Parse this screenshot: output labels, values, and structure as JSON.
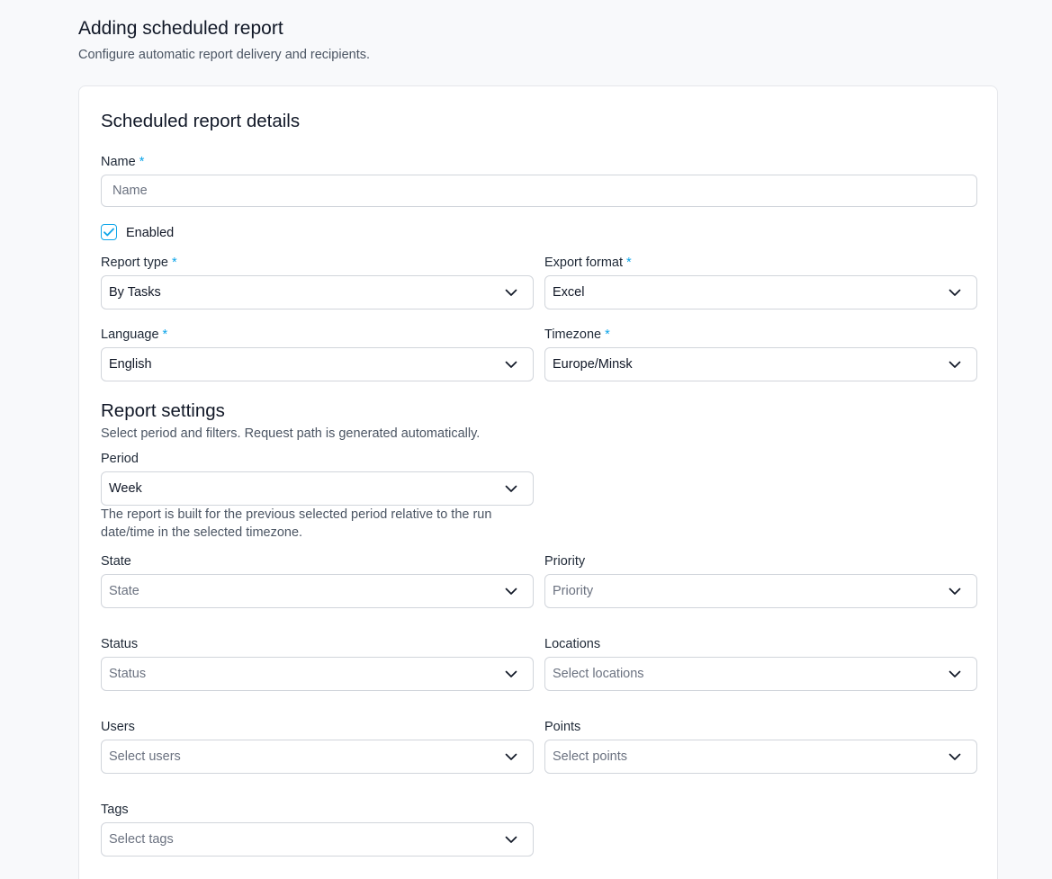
{
  "page": {
    "title": "Adding scheduled report",
    "subtitle": "Configure automatic report delivery and recipients."
  },
  "details": {
    "title": "Scheduled report details",
    "name": {
      "label": "Name",
      "required_mark": "*",
      "value": "",
      "placeholder": "Name"
    },
    "enabled": {
      "label": "Enabled",
      "checked": true
    },
    "report_type": {
      "label": "Report type",
      "required_mark": "*",
      "value": "By Tasks"
    },
    "export_format": {
      "label": "Export format",
      "required_mark": "*",
      "value": "Excel"
    },
    "language": {
      "label": "Language",
      "required_mark": "*",
      "value": "English"
    },
    "timezone": {
      "label": "Timezone",
      "required_mark": "*",
      "value": "Europe/Minsk"
    }
  },
  "settings": {
    "title": "Report settings",
    "description": "Select period and filters. Request path is generated automatically.",
    "period": {
      "label": "Period",
      "value": "Week",
      "hint_line1": "The report is built for the previous selected period relative to the run",
      "hint_line2": "date/time in the selected timezone."
    },
    "state": {
      "label": "State",
      "placeholder": "State"
    },
    "priority": {
      "label": "Priority",
      "placeholder": "Priority"
    },
    "status": {
      "label": "Status",
      "placeholder": "Status"
    },
    "locations": {
      "label": "Locations",
      "placeholder": "Select locations"
    },
    "users": {
      "label": "Users",
      "placeholder": "Select users"
    },
    "points": {
      "label": "Points",
      "placeholder": "Select points"
    },
    "tags": {
      "label": "Tags",
      "placeholder": "Select tags"
    }
  },
  "icons": {
    "dropdown": "chevron-down-icon",
    "check": "check-icon"
  },
  "colors": {
    "accent": "#0ea5e9",
    "border": "#d1d5db",
    "background": "#f8f9fb"
  }
}
